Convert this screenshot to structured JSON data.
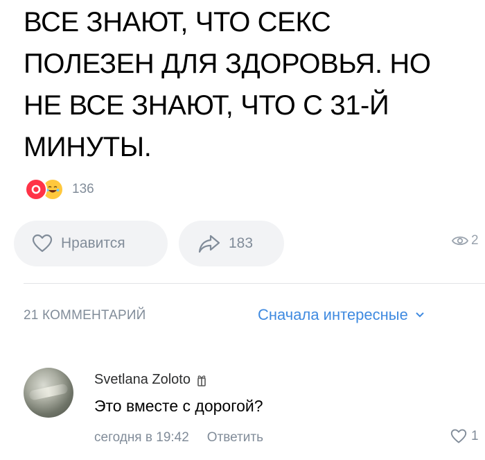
{
  "post": {
    "text": "ВСЕ ЗНАЮТ, ЧТО СЕКС\nПОЛЕЗЕН ДЛЯ ЗДОРОВЬЯ. НО\nНЕ ВСЕ ЗНАЮТ, ЧТО С 31-Й\nМИНУТЫ.",
    "reactions": {
      "icons": [
        "heart-icon",
        "laughing-emoji-icon"
      ],
      "count": "136"
    }
  },
  "actions": {
    "like_label": "Нравится",
    "share_count": "183",
    "views_count": "2"
  },
  "comments": {
    "count_label": "21 КОММЕНТАРИЙ",
    "sort_label": "Сначала интересные",
    "items": [
      {
        "author": "Svetlana Zoloto",
        "text": "Это вместе с дорогой?",
        "time": "сегодня в 19:42",
        "reply_label": "Ответить",
        "likes": "1"
      }
    ]
  },
  "colors": {
    "accent": "#3f8ae0",
    "secondary_text": "#818c99",
    "pill_bg": "#f2f3f5",
    "heart_reaction": "#ff3347"
  }
}
